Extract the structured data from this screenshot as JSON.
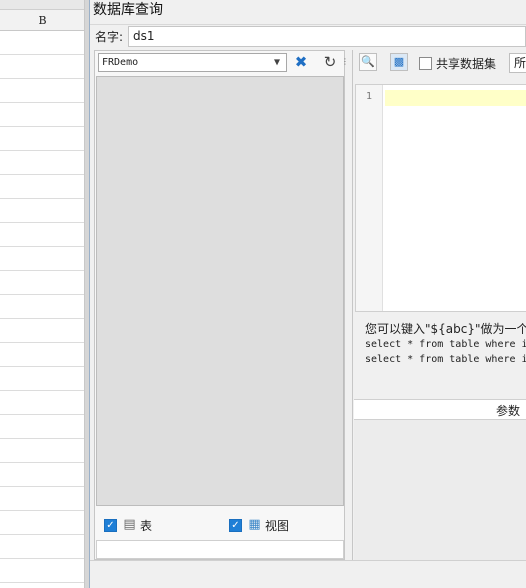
{
  "sheet": {
    "column_header": "B"
  },
  "dialog": {
    "title": "数据库查询",
    "name_label": "名字:",
    "name_value": "ds1"
  },
  "left_panel": {
    "connection": "FRDemo",
    "tables_label": "表",
    "views_label": "视图",
    "tables_checked": true,
    "views_checked": true
  },
  "right_panel": {
    "share_label": "共享数据集",
    "tab_label": "所",
    "line_number": "1",
    "hint_line1": "您可以键入\"${abc}\"做为一个参",
    "hint_line2": "select * from table where i",
    "hint_line3": "select * from table where i",
    "params_header": "参数"
  },
  "colors": {
    "accent": "#1f7fd6",
    "current_line": "#ffffc8",
    "tree_bg": "#dedede"
  }
}
